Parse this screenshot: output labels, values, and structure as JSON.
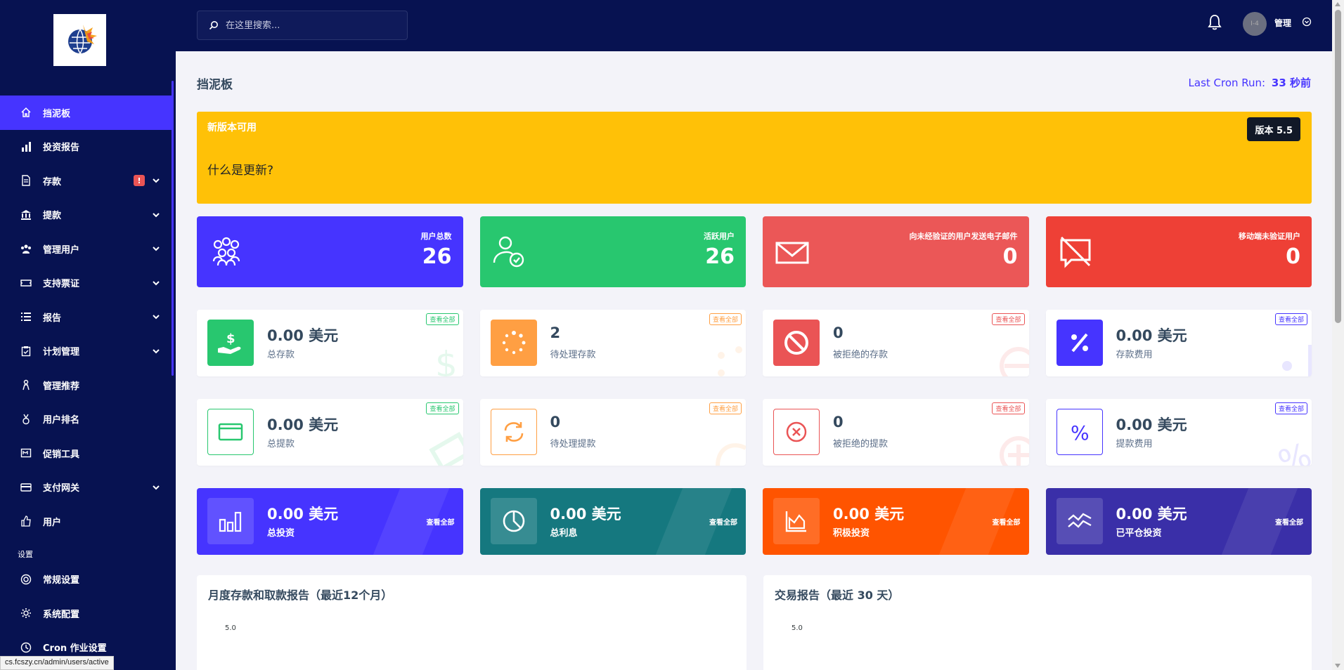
{
  "sidebar": {
    "items": [
      {
        "label": "挡泥板",
        "icon": "home-icon"
      },
      {
        "label": "投资报告",
        "icon": "bar-chart-icon"
      },
      {
        "label": "存款",
        "icon": "deposit-icon",
        "badge": "!"
      },
      {
        "label": "提款",
        "icon": "bank-icon"
      },
      {
        "label": "管理用户",
        "icon": "users-icon"
      },
      {
        "label": "支持票证",
        "icon": "ticket-icon"
      },
      {
        "label": "报告",
        "icon": "list-icon"
      },
      {
        "label": "计划管理",
        "icon": "clipboard-icon"
      },
      {
        "label": "管理推荐",
        "icon": "referral-icon"
      },
      {
        "label": "用户排名",
        "icon": "medal-icon"
      },
      {
        "label": "促销工具",
        "icon": "promo-icon"
      },
      {
        "label": "支付网关",
        "icon": "card-icon"
      },
      {
        "label": "用户",
        "icon": "thumbs-up-icon"
      }
    ],
    "section_label": "设置",
    "settings_items": [
      {
        "label": "常规设置",
        "icon": "life-ring-icon"
      },
      {
        "label": "系统配置",
        "icon": "gear-icon"
      },
      {
        "label": "Cron 作业设置",
        "icon": "clock-icon"
      }
    ]
  },
  "status_url": "cs.fcszy.cn/admin/users/active",
  "topbar": {
    "search_placeholder": "在这里搜索...",
    "avatar_text": "I-4",
    "admin_name": "管理"
  },
  "page": {
    "title": "挡泥板",
    "cron_label": "Last Cron Run:",
    "cron_value": "33 秒前"
  },
  "banner": {
    "title": "新版本可用",
    "subtitle": "什么是更新?",
    "version_button": "版本 5.5",
    "color": "#ffc107"
  },
  "stats": [
    {
      "label": "用户总数",
      "value": "26",
      "color": "#4634ff",
      "icon": "users-group-icon"
    },
    {
      "label": "活跃用户",
      "value": "26",
      "color": "#28c76f",
      "icon": "user-check-icon"
    },
    {
      "label": "向未经验证的用户发送电子邮件",
      "value": "0",
      "color": "#eb5757",
      "icon": "envelope-icon"
    },
    {
      "label": "移动端未验证用户",
      "value": "0",
      "color": "#ee4036",
      "icon": "comment-slash-icon"
    }
  ],
  "deposit_widgets": [
    {
      "value": "0.00 美元",
      "label": "总存款",
      "view_all": "查看全部",
      "color": "#28c76f",
      "icon": "hand-holding-dollar-icon"
    },
    {
      "value": "2",
      "label": "待处理存款",
      "view_all": "查看全部",
      "color": "#ff9f43",
      "icon": "spinner-icon"
    },
    {
      "value": "0",
      "label": "被拒绝的存款",
      "view_all": "查看全部",
      "color": "#ea5455",
      "icon": "ban-icon"
    },
    {
      "value": "0.00 美元",
      "label": "存款费用",
      "view_all": "查看全部",
      "color": "#4634ff",
      "icon": "percent-icon"
    }
  ],
  "withdraw_widgets": [
    {
      "value": "0.00 美元",
      "label": "总提款",
      "view_all": "查看全部",
      "color": "#28c76f",
      "icon": "credit-card-icon"
    },
    {
      "value": "0",
      "label": "待处理提款",
      "view_all": "查看全部",
      "color": "#ff9f43",
      "icon": "sync-icon"
    },
    {
      "value": "0",
      "label": "被拒绝的提款",
      "view_all": "查看全部",
      "color": "#ea5455",
      "icon": "times-circle-icon"
    },
    {
      "value": "0.00 美元",
      "label": "提款费用",
      "view_all": "查看全部",
      "color": "#4634ff",
      "icon": "percent-icon"
    }
  ],
  "invest_widgets": [
    {
      "value": "0.00 美元",
      "label": "总投资",
      "view_all": "查看全部",
      "color": "#4634ff",
      "icon": "chart-bars-icon"
    },
    {
      "value": "0.00 美元",
      "label": "总利息",
      "view_all": "查看全部",
      "color": "#15787f",
      "icon": "pie-chart-icon"
    },
    {
      "value": "0.00 美元",
      "label": "积极投资",
      "view_all": "查看全部",
      "color": "#ff5400",
      "icon": "chart-area-icon"
    },
    {
      "value": "0.00 美元",
      "label": "已平仓投资",
      "view_all": "查看全部",
      "color": "#3a2fa8",
      "icon": "wave-icon"
    }
  ],
  "charts": [
    {
      "title": "月度存款和取款报告（最近12个月）",
      "ytick": "5.0"
    },
    {
      "title": "交易报告（最近 30 天）",
      "ytick": "5.0"
    }
  ]
}
